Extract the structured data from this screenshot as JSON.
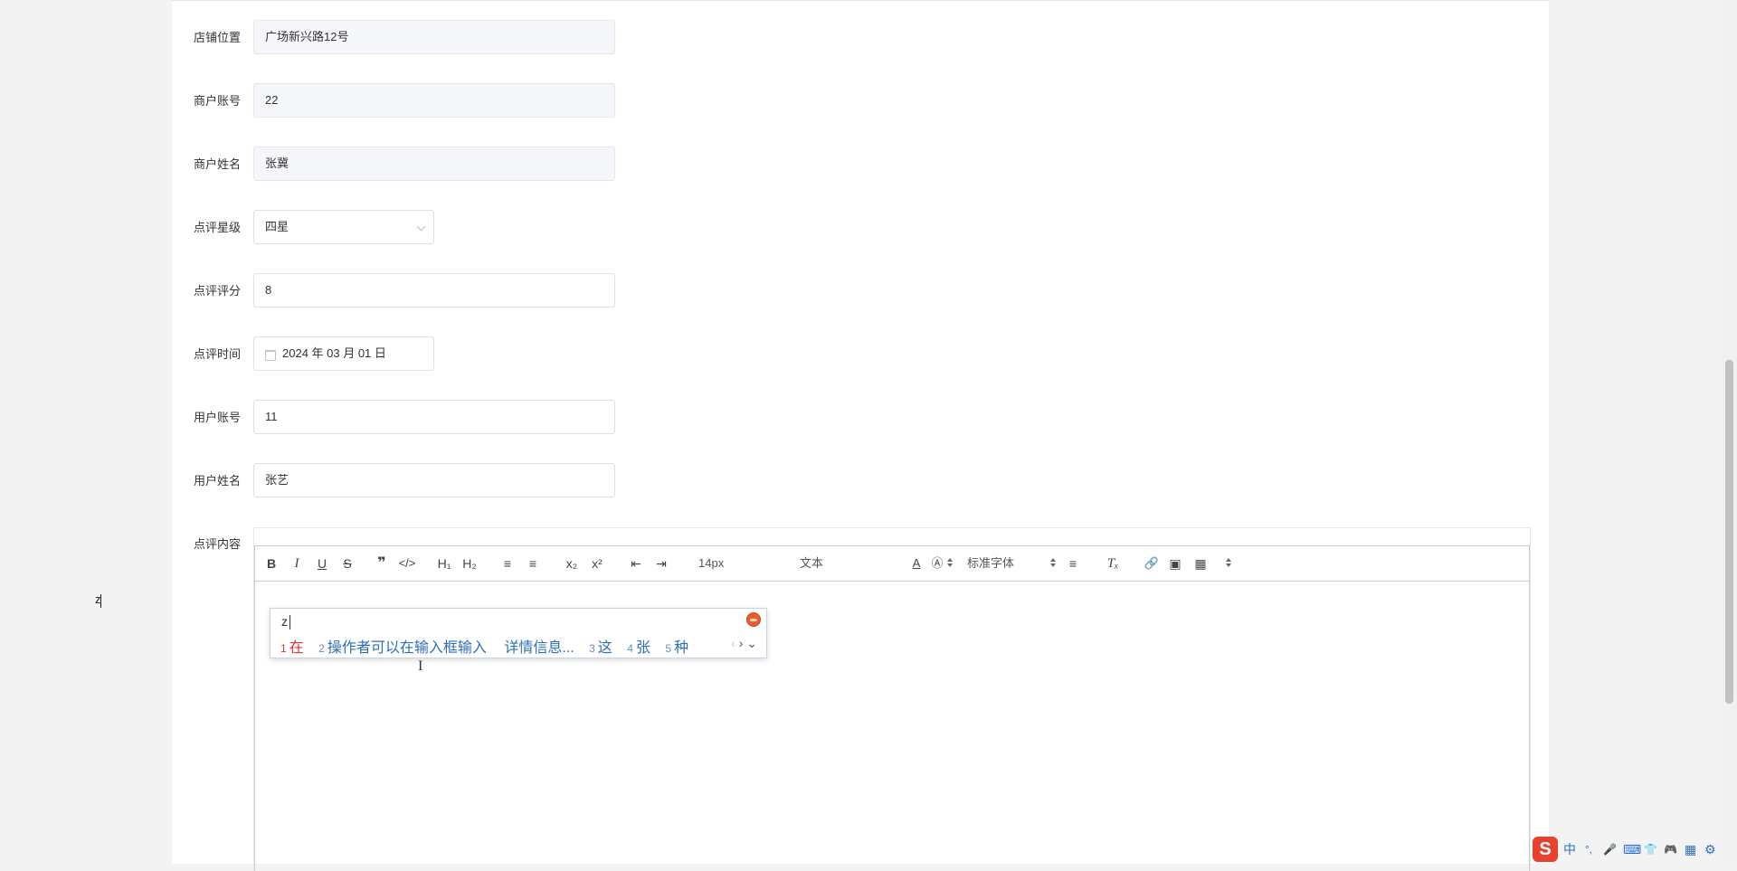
{
  "form": {
    "shop_location": {
      "label": "店铺位置",
      "value": "广场新兴路12号"
    },
    "merchant_account": {
      "label": "商户账号",
      "value": "22"
    },
    "merchant_name": {
      "label": "商户姓名",
      "value": "张冀"
    },
    "review_level": {
      "label": "点评星级",
      "value": "四星"
    },
    "review_score": {
      "label": "点评评分",
      "value": "8"
    },
    "review_time": {
      "label": "点评时间",
      "value": "2024 年 03 月 01 日"
    },
    "user_account": {
      "label": "用户账号",
      "value": "11"
    },
    "user_name": {
      "label": "用户姓名",
      "value": "张艺"
    },
    "review_content": {
      "label": "点评内容"
    }
  },
  "editor": {
    "toolbar": {
      "bold": "B",
      "italic": "I",
      "underline": "U",
      "strike": "S",
      "quote": "❞",
      "code": "</>",
      "h1": "H₁",
      "h2": "H₂",
      "ordered_list": "≡",
      "bullet_list": "≡",
      "subscript": "x₂",
      "superscript": "x²",
      "outdent": "⇤",
      "indent": "⇥",
      "font_size": "14px",
      "header_type": "文本",
      "font_family": "标准字体",
      "align": "≡",
      "clear_format": "Tₓ",
      "link": "🔗",
      "image": "▣",
      "video": "▦"
    },
    "typed_text": "z"
  },
  "ime": {
    "composition": "z",
    "candidates": [
      {
        "num": "1",
        "text": "在"
      },
      {
        "num": "2",
        "text": "操作者可以在输入框输入"
      },
      {
        "num": "",
        "text": "详情信息..."
      },
      {
        "num": "3",
        "text": "这"
      },
      {
        "num": "4",
        "text": "张"
      },
      {
        "num": "5",
        "text": "种"
      }
    ],
    "prev": "‹",
    "next": "›",
    "expand": "⌄"
  },
  "tray": {
    "input_mode": "中",
    "punct": "°,",
    "mic": "🎤",
    "keyboard": "⌨",
    "skin": "👕",
    "game": "🎮",
    "apps": "▦",
    "settings": "⚙",
    "logo": "S"
  }
}
